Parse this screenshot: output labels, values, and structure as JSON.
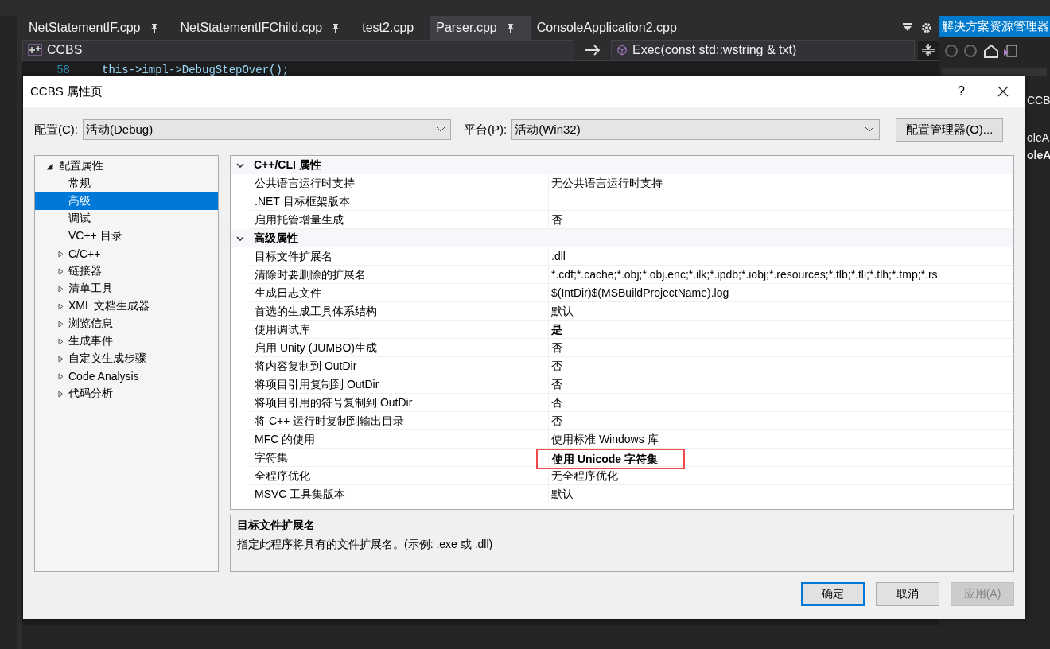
{
  "editor_tabs": [
    {
      "label": "NetStatementIF.cpp",
      "pinned": true,
      "selected": false
    },
    {
      "label": "NetStatementIFChild.cpp",
      "pinned": true,
      "selected": false
    },
    {
      "label": "test2.cpp",
      "pinned": false,
      "selected": false
    },
    {
      "label": "Parser.cpp",
      "pinned": true,
      "selected": true
    },
    {
      "label": "ConsoleApplication2.cpp",
      "pinned": false,
      "selected": false
    }
  ],
  "nav_bar": {
    "project": "CCBS",
    "member": "Exec(const std::wstring & txt)"
  },
  "code_line": {
    "number": "58",
    "text": "this->impl->DebugStepOver();"
  },
  "solution_explorer": {
    "title": "解决方案资源管理器",
    "items": [
      {
        "label": "CCB",
        "bold": false
      },
      {
        "label": "oleA",
        "bold": false
      },
      {
        "label": "oleA",
        "bold": true
      }
    ]
  },
  "dialog": {
    "title": "CCBS 属性页",
    "help": "?",
    "config": {
      "label": "配置(C):",
      "value": "活动(Debug)"
    },
    "platform": {
      "label": "平台(P):",
      "value": "活动(Win32)"
    },
    "manager_button": "配置管理器(O)...",
    "tree": [
      {
        "label": "配置属性",
        "expanded": true,
        "children": [
          {
            "label": "常规",
            "selected": false
          },
          {
            "label": "高级",
            "selected": true
          },
          {
            "label": "调试",
            "selected": false
          },
          {
            "label": "VC++ 目录",
            "selected": false
          },
          {
            "label": "C/C++",
            "expanded": false,
            "selected": false
          },
          {
            "label": "链接器",
            "expanded": false,
            "selected": false
          },
          {
            "label": "清单工具",
            "expanded": false,
            "selected": false
          },
          {
            "label": "XML 文档生成器",
            "expanded": false,
            "selected": false
          },
          {
            "label": "浏览信息",
            "expanded": false,
            "selected": false
          },
          {
            "label": "生成事件",
            "expanded": false,
            "selected": false
          },
          {
            "label": "自定义生成步骤",
            "expanded": false,
            "selected": false
          },
          {
            "label": "Code Analysis",
            "expanded": false,
            "selected": false
          },
          {
            "label": "代码分析",
            "expanded": false,
            "selected": false
          }
        ]
      }
    ],
    "groups": [
      {
        "title": "C++/CLI 属性",
        "expanded": true,
        "rows": [
          {
            "name": "公共语言运行时支持",
            "value": "无公共语言运行时支持",
            "modified": false,
            "highlighted": false
          },
          {
            "name": ".NET 目标框架版本",
            "value": "",
            "modified": false,
            "highlighted": false
          },
          {
            "name": "启用托管增量生成",
            "value": "否",
            "modified": false,
            "highlighted": false
          }
        ]
      },
      {
        "title": "高级属性",
        "expanded": true,
        "rows": [
          {
            "name": "目标文件扩展名",
            "value": ".dll",
            "modified": false,
            "highlighted": false
          },
          {
            "name": "清除时要删除的扩展名",
            "value": "*.cdf;*.cache;*.obj;*.obj.enc;*.ilk;*.ipdb;*.iobj;*.resources;*.tlb;*.tli;*.tlh;*.tmp;*.rs",
            "modified": false,
            "highlighted": false
          },
          {
            "name": "生成日志文件",
            "value": "$(IntDir)$(MSBuildProjectName).log",
            "modified": false,
            "highlighted": false
          },
          {
            "name": "首选的生成工具体系结构",
            "value": "默认",
            "modified": false,
            "highlighted": false
          },
          {
            "name": "使用调试库",
            "value": "是",
            "modified": true,
            "highlighted": false
          },
          {
            "name": "启用 Unity (JUMBO)生成",
            "value": "否",
            "modified": false,
            "highlighted": false
          },
          {
            "name": "将内容复制到 OutDir",
            "value": "否",
            "modified": false,
            "highlighted": false
          },
          {
            "name": "将项目引用复制到 OutDir",
            "value": "否",
            "modified": false,
            "highlighted": false
          },
          {
            "name": "将项目引用的符号复制到 OutDir",
            "value": "否",
            "modified": false,
            "highlighted": false
          },
          {
            "name": "将 C++ 运行时复制到输出目录",
            "value": "否",
            "modified": false,
            "highlighted": false
          },
          {
            "name": "MFC 的使用",
            "value": "使用标准 Windows 库",
            "modified": false,
            "highlighted": false
          },
          {
            "name": "字符集",
            "value": "使用 Unicode 字符集",
            "modified": true,
            "highlighted": true
          },
          {
            "name": "全程序优化",
            "value": "无全程序优化",
            "modified": false,
            "highlighted": false
          },
          {
            "name": "MSVC 工具集版本",
            "value": "默认",
            "modified": false,
            "highlighted": false
          }
        ]
      }
    ],
    "description": {
      "title": "目标文件扩展名",
      "text": "指定此程序将具有的文件扩展名。(示例: .exe 或 .dll)"
    },
    "buttons": [
      {
        "label": "确定",
        "default": true,
        "disabled": false
      },
      {
        "label": "取消",
        "default": false,
        "disabled": false
      },
      {
        "label": "应用(A)",
        "default": false,
        "disabled": true
      }
    ]
  }
}
